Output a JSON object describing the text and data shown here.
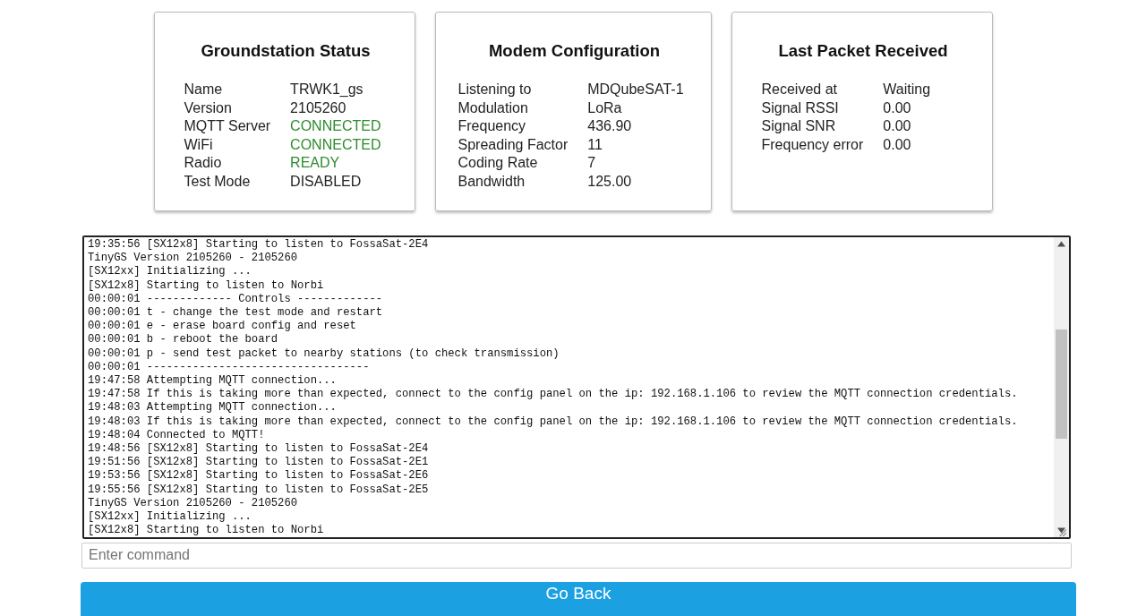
{
  "cards": [
    {
      "title": "Groundstation Status",
      "rows": [
        {
          "label": "Name",
          "value": "TRWK1_gs",
          "highlighted": false
        },
        {
          "label": "Version",
          "value": "2105260",
          "highlighted": false
        },
        {
          "label": "MQTT Server",
          "value": "CONNECTED",
          "highlighted": true
        },
        {
          "label": "WiFi",
          "value": "CONNECTED",
          "highlighted": true
        },
        {
          "label": "Radio",
          "value": "READY",
          "highlighted": true
        },
        {
          "label": "Test Mode",
          "value": "DISABLED",
          "highlighted": false
        }
      ]
    },
    {
      "title": "Modem Configuration",
      "rows": [
        {
          "label": "Listening to",
          "value": "MDQubeSAT-1",
          "highlighted": false
        },
        {
          "label": "Modulation",
          "value": "LoRa",
          "highlighted": false
        },
        {
          "label": "Frequency",
          "value": "436.90",
          "highlighted": false
        },
        {
          "label": "Spreading Factor",
          "value": "11",
          "highlighted": false
        },
        {
          "label": "Coding Rate",
          "value": "7",
          "highlighted": false
        },
        {
          "label": "Bandwidth",
          "value": "125.00",
          "highlighted": false
        }
      ]
    },
    {
      "title": "Last Packet Received",
      "rows": [
        {
          "label": "Received at",
          "value": "Waiting",
          "highlighted": false
        },
        {
          "label": "Signal RSSI",
          "value": "0.00",
          "highlighted": false
        },
        {
          "label": "Signal SNR",
          "value": "0.00",
          "highlighted": false
        },
        {
          "label": "Frequency error",
          "value": "0.00",
          "highlighted": false
        }
      ]
    }
  ],
  "console": {
    "lines": [
      "19:35:56 [SX12x8] Starting to listen to FossaSat-2E4",
      "TinyGS Version 2105260 - 2105260",
      "[SX12xx] Initializing ...",
      "[SX12x8] Starting to listen to Norbi",
      "00:00:01 ------------- Controls -------------",
      "00:00:01 t - change the test mode and restart",
      "00:00:01 e - erase board config and reset",
      "00:00:01 b - reboot the board",
      "00:00:01 p - send test packet to nearby stations (to check transmission)",
      "00:00:01 ----------------------------------",
      "19:47:58 Attempting MQTT connection...",
      "19:47:58 If this is taking more than expected, connect to the config panel on the ip: 192.168.1.106 to review the MQTT connection credentials.",
      "19:48:03 Attempting MQTT connection...",
      "19:48:03 If this is taking more than expected, connect to the config panel on the ip: 192.168.1.106 to review the MQTT connection credentials.",
      "19:48:04 Connected to MQTT!",
      "19:48:56 [SX12x8] Starting to listen to FossaSat-2E4",
      "19:51:56 [SX12x8] Starting to listen to FossaSat-2E1",
      "19:53:56 [SX12x8] Starting to listen to FossaSat-2E6",
      "19:55:56 [SX12x8] Starting to listen to FossaSat-2E5",
      "TinyGS Version 2105260 - 2105260",
      "[SX12xx] Initializing ...",
      "[SX12x8] Starting to listen to Norbi"
    ]
  },
  "command": {
    "placeholder": "Enter command"
  },
  "back_button": "Go Back"
}
